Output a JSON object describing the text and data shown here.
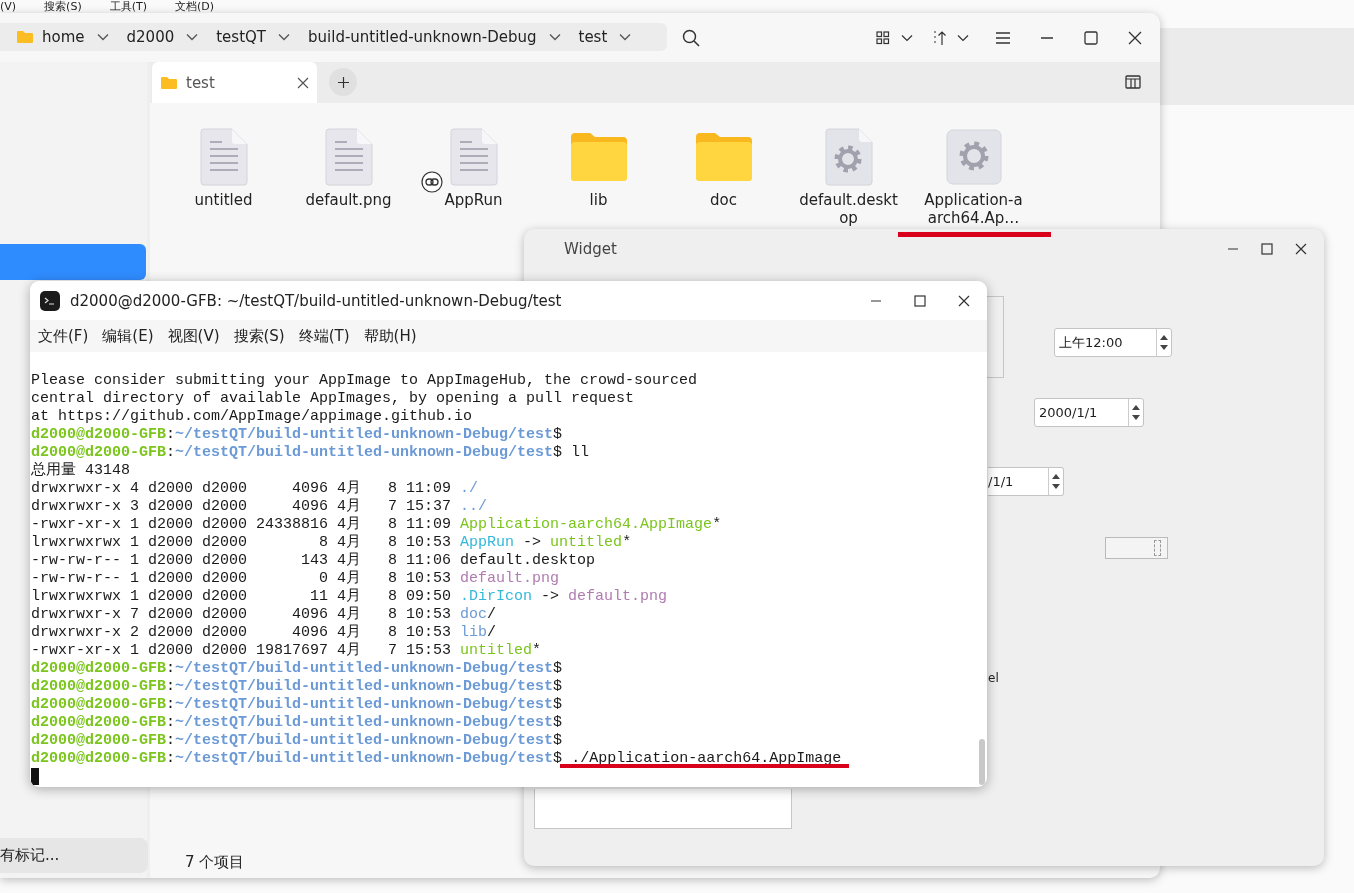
{
  "background_app": {
    "menu": [
      "(V)",
      "搜索(S)",
      "工具(T)",
      "文档(D)"
    ]
  },
  "file_manager": {
    "breadcrumb": [
      {
        "label": "home",
        "kind": "folder"
      },
      {
        "label": "d2000",
        "kind": "plain"
      },
      {
        "label": "testQT",
        "kind": "plain"
      },
      {
        "label": "build-untitled-unknown-Debug",
        "kind": "plain"
      },
      {
        "label": "test",
        "kind": "plain"
      }
    ],
    "sidebar": {
      "items": [
        {
          "selected": true
        }
      ],
      "tags_button": "有标记..."
    },
    "tabs": [
      {
        "label": "test",
        "selected": true
      }
    ],
    "files": [
      {
        "name": "untitled",
        "kind": "text",
        "link": false,
        "underlined": false
      },
      {
        "name": "default.png",
        "kind": "text",
        "link": false,
        "underlined": false
      },
      {
        "name": "AppRun",
        "kind": "text",
        "link": true,
        "underlined": false
      },
      {
        "name": "lib",
        "kind": "folder",
        "link": false,
        "underlined": false
      },
      {
        "name": "doc",
        "kind": "folder",
        "link": false,
        "underlined": false
      },
      {
        "name": "default.desktop",
        "kind": "gear-doc",
        "link": false,
        "underlined": false
      },
      {
        "name": "Application-aarch64.Ap…",
        "kind": "gear-app",
        "link": false,
        "underlined": true
      }
    ],
    "status": "7 个项目"
  },
  "widget_window": {
    "title": "Widget",
    "time_edit": "上午12:00",
    "date_edit": "2000/1/1",
    "date_edit_2": "/1/1",
    "label": "el"
  },
  "terminal": {
    "title": "d2000@d2000-GFB: ~/testQT/build-untitled-unknown-Debug/test",
    "menu": [
      "文件(F)",
      "编辑(E)",
      "视图(V)",
      "搜索(S)",
      "终端(T)",
      "帮助(H)"
    ],
    "cursor": true,
    "lines": [
      {
        "underlined": false,
        "segments": [
          {
            "text": "Please consider submitting your AppImage to AppImageHub, the crowd-sourced",
            "kind": "plain"
          }
        ]
      },
      {
        "underlined": false,
        "segments": [
          {
            "text": "central directory of available AppImages, by opening a pull request",
            "kind": "plain"
          }
        ]
      },
      {
        "underlined": false,
        "segments": [
          {
            "text": "at https://github.com/AppImage/appimage.github.io",
            "kind": "plain"
          }
        ]
      },
      {
        "underlined": false,
        "segments": [
          {
            "text": "d2000@d2000-GFB",
            "kind": "user"
          },
          {
            "text": ":",
            "kind": "plain"
          },
          {
            "text": "~/testQT/build-untitled-unknown-Debug/test",
            "kind": "path"
          },
          {
            "text": "$",
            "kind": "plain"
          }
        ]
      },
      {
        "underlined": false,
        "segments": [
          {
            "text": "d2000@d2000-GFB",
            "kind": "user"
          },
          {
            "text": ":",
            "kind": "plain"
          },
          {
            "text": "~/testQT/build-untitled-unknown-Debug/test",
            "kind": "path"
          },
          {
            "text": "$ ll",
            "kind": "plain"
          }
        ]
      },
      {
        "underlined": false,
        "segments": [
          {
            "text": "总用量 43148",
            "kind": "plain"
          }
        ]
      },
      {
        "underlined": false,
        "segments": [
          {
            "text": "drwxrwxr-x 4 d2000 d2000     4096 4月   8 11:09 ",
            "kind": "plain"
          },
          {
            "text": "./",
            "kind": "dir"
          }
        ]
      },
      {
        "underlined": false,
        "segments": [
          {
            "text": "drwxrwxr-x 3 d2000 d2000     4096 4月   7 15:37 ",
            "kind": "plain"
          },
          {
            "text": "../",
            "kind": "dir"
          }
        ]
      },
      {
        "underlined": false,
        "segments": [
          {
            "text": "-rwxr-xr-x 1 d2000 d2000 24338816 4月   8 11:09 ",
            "kind": "plain"
          },
          {
            "text": "Application-aarch64.AppImage",
            "kind": "exec"
          },
          {
            "text": "*",
            "kind": "plain"
          }
        ]
      },
      {
        "underlined": false,
        "segments": [
          {
            "text": "lrwxrwxrwx 1 d2000 d2000        8 4月   8 10:53 ",
            "kind": "plain"
          },
          {
            "text": "AppRun",
            "kind": "link"
          },
          {
            "text": " -> ",
            "kind": "plain"
          },
          {
            "text": "untitled",
            "kind": "exec"
          },
          {
            "text": "*",
            "kind": "plain"
          }
        ]
      },
      {
        "underlined": false,
        "segments": [
          {
            "text": "-rw-rw-r-- 1 d2000 d2000      143 4月   8 11:06 default.desktop",
            "kind": "plain"
          }
        ]
      },
      {
        "underlined": false,
        "segments": [
          {
            "text": "-rw-rw-r-- 1 d2000 d2000        0 4月   8 10:53 ",
            "kind": "plain"
          },
          {
            "text": "default.png",
            "kind": "image"
          }
        ]
      },
      {
        "underlined": false,
        "segments": [
          {
            "text": "lrwxrwxrwx 1 d2000 d2000       11 4月   8 09:50 ",
            "kind": "plain"
          },
          {
            "text": ".DirIcon",
            "kind": "link"
          },
          {
            "text": " -> ",
            "kind": "plain"
          },
          {
            "text": "default.png",
            "kind": "image"
          }
        ]
      },
      {
        "underlined": false,
        "segments": [
          {
            "text": "drwxrwxr-x 7 d2000 d2000     4096 4月   8 10:53 ",
            "kind": "plain"
          },
          {
            "text": "doc",
            "kind": "dir"
          },
          {
            "text": "/",
            "kind": "plain"
          }
        ]
      },
      {
        "underlined": false,
        "segments": [
          {
            "text": "drwxrwxr-x 2 d2000 d2000     4096 4月   8 10:53 ",
            "kind": "plain"
          },
          {
            "text": "lib",
            "kind": "dir"
          },
          {
            "text": "/",
            "kind": "plain"
          }
        ]
      },
      {
        "underlined": false,
        "segments": [
          {
            "text": "-rwxr-xr-x 1 d2000 d2000 19817697 4月   7 15:53 ",
            "kind": "plain"
          },
          {
            "text": "untitled",
            "kind": "exec"
          },
          {
            "text": "*",
            "kind": "plain"
          }
        ]
      },
      {
        "underlined": false,
        "segments": [
          {
            "text": "d2000@d2000-GFB",
            "kind": "user"
          },
          {
            "text": ":",
            "kind": "plain"
          },
          {
            "text": "~/testQT/build-untitled-unknown-Debug/test",
            "kind": "path"
          },
          {
            "text": "$",
            "kind": "plain"
          }
        ]
      },
      {
        "underlined": false,
        "segments": [
          {
            "text": "d2000@d2000-GFB",
            "kind": "user"
          },
          {
            "text": ":",
            "kind": "plain"
          },
          {
            "text": "~/testQT/build-untitled-unknown-Debug/test",
            "kind": "path"
          },
          {
            "text": "$",
            "kind": "plain"
          }
        ]
      },
      {
        "underlined": false,
        "segments": [
          {
            "text": "d2000@d2000-GFB",
            "kind": "user"
          },
          {
            "text": ":",
            "kind": "plain"
          },
          {
            "text": "~/testQT/build-untitled-unknown-Debug/test",
            "kind": "path"
          },
          {
            "text": "$",
            "kind": "plain"
          }
        ]
      },
      {
        "underlined": false,
        "segments": [
          {
            "text": "d2000@d2000-GFB",
            "kind": "user"
          },
          {
            "text": ":",
            "kind": "plain"
          },
          {
            "text": "~/testQT/build-untitled-unknown-Debug/test",
            "kind": "path"
          },
          {
            "text": "$",
            "kind": "plain"
          }
        ]
      },
      {
        "underlined": false,
        "segments": [
          {
            "text": "d2000@d2000-GFB",
            "kind": "user"
          },
          {
            "text": ":",
            "kind": "plain"
          },
          {
            "text": "~/testQT/build-untitled-unknown-Debug/test",
            "kind": "path"
          },
          {
            "text": "$",
            "kind": "plain"
          }
        ]
      },
      {
        "underlined": true,
        "segments": [
          {
            "text": "d2000@d2000-GFB",
            "kind": "user"
          },
          {
            "text": ":",
            "kind": "plain"
          },
          {
            "text": "~/testQT/build-untitled-unknown-Debug/test",
            "kind": "path"
          },
          {
            "text": "$ ",
            "kind": "plain"
          },
          {
            "text": "./Application-aarch64.AppImage",
            "kind": "cmd"
          }
        ]
      }
    ]
  }
}
